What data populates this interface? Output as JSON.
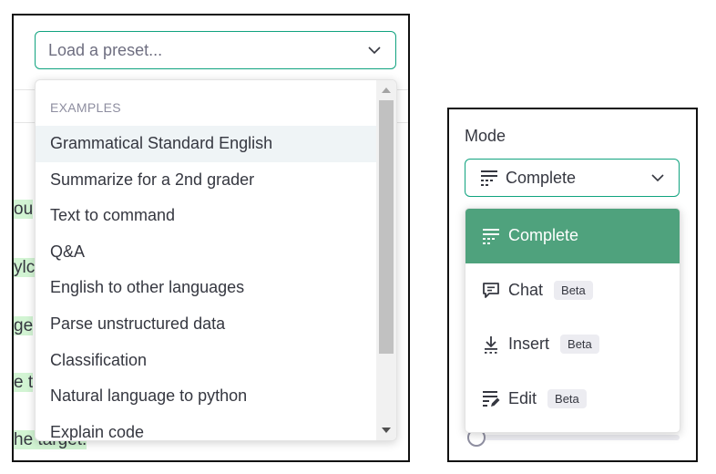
{
  "preset": {
    "placeholder": "Load a preset...",
    "dropdown_header": "EXAMPLES",
    "items": [
      "Grammatical Standard English",
      "Summarize for a 2nd grader",
      "Text to command",
      "Q&A",
      "English to other languages",
      "Parse unstructured data",
      "Classification",
      "Natural language to python",
      "Explain code"
    ],
    "hovered_index": 0
  },
  "background_fragments": [
    "ou",
    "ylc",
    "ge",
    "e t",
    "he target."
  ],
  "mode": {
    "label": "Mode",
    "selected": "Complete",
    "options": [
      {
        "label": "Complete",
        "icon": "complete-icon",
        "badge": ""
      },
      {
        "label": "Chat",
        "icon": "chat-icon",
        "badge": "Beta"
      },
      {
        "label": "Insert",
        "icon": "insert-icon",
        "badge": "Beta"
      },
      {
        "label": "Edit",
        "icon": "edit-icon",
        "badge": "Beta"
      }
    ]
  },
  "colors": {
    "accent": "#10a37f",
    "active_item": "#4fa27d",
    "highlight": "#d2f4d3"
  }
}
